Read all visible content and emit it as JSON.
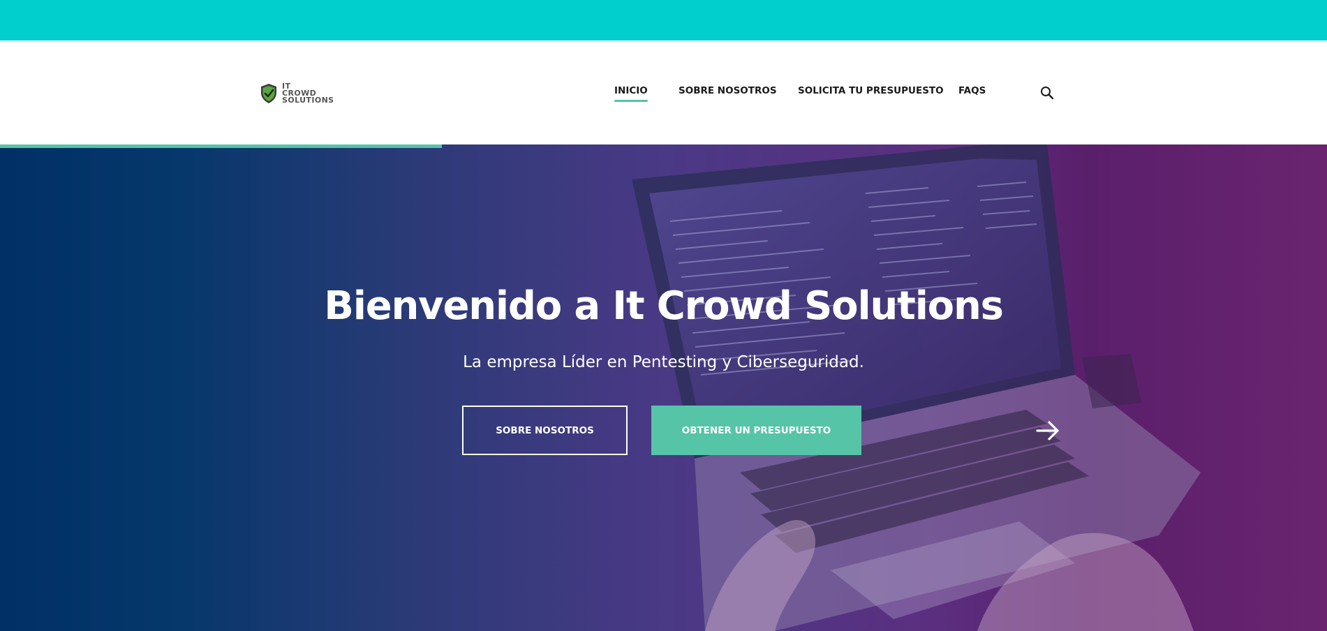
{
  "colors": {
    "top_bar": "#00cfcd",
    "accent": "#55c4a7",
    "hero_gradient_start": "#003066",
    "hero_gradient_end": "#6a246f",
    "text_dark": "#1a1a1a",
    "text_light": "#ffffff"
  },
  "logo": {
    "lines": [
      "IT",
      "CROWD",
      "SOLUTIONS"
    ],
    "icon": "shield-check-icon"
  },
  "nav": {
    "items": [
      {
        "label": "INICIO",
        "active": true
      },
      {
        "label": "SOBRE NOSOTROS",
        "active": false
      },
      {
        "label": "SOLICITA TU PRESUPUESTO",
        "active": false
      },
      {
        "label": "FAQS",
        "active": false
      }
    ],
    "search_icon": "search-icon"
  },
  "hero": {
    "title": "Bienvenido a It Crowd Solutions",
    "subtitle": "La empresa Líder en Pentesting y Ciberseguridad.",
    "buttons": {
      "secondary": "SOBRE NOSOTROS",
      "primary": "OBTENER UN PRESUPUESTO"
    },
    "next_icon": "arrow-right-icon",
    "slide_progress": 0.333
  }
}
